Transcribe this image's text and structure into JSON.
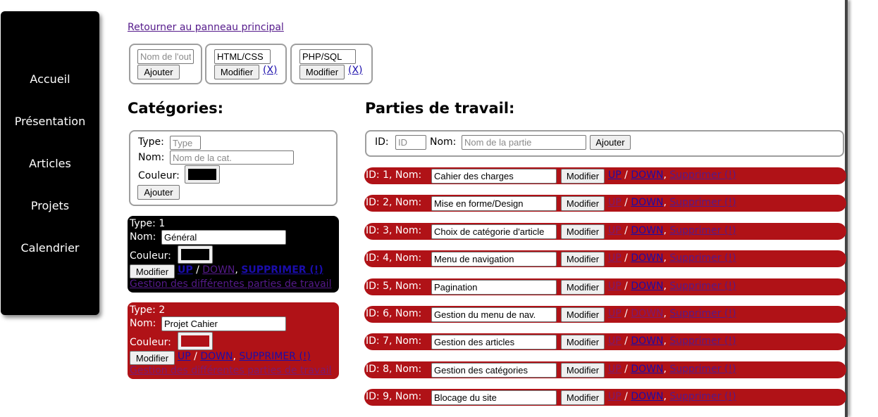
{
  "sidebar": {
    "items": [
      {
        "label": "Accueil"
      },
      {
        "label": "Présentation"
      },
      {
        "label": "Articles"
      },
      {
        "label": "Projets"
      },
      {
        "label": "Calendrier"
      }
    ]
  },
  "back_link": "Retourner au panneau principal",
  "tools": {
    "new": {
      "placeholder": "Nom de l'outil",
      "add_label": "Ajouter"
    },
    "items": [
      {
        "value": "HTML/CSS",
        "modify_label": "Modifier",
        "delete_label": "(X)"
      },
      {
        "value": "PHP/SQL",
        "modify_label": "Modifier",
        "delete_label": "(X)"
      }
    ]
  },
  "categories": {
    "title": "Catégories:",
    "form": {
      "type_label": "Type:",
      "type_placeholder": "Type",
      "name_label": "Nom:",
      "name_placeholder": "Nom de la cat.",
      "color_label": "Couleur:",
      "color_value": "#000000",
      "add_label": "Ajouter"
    },
    "items": [
      {
        "type_text": "Type: 1",
        "name_label": "Nom:",
        "name_value": "Général",
        "color_label": "Couleur:",
        "color": "#000000",
        "bg": "#000000",
        "modify_label": "Modifier",
        "up_label": "UP",
        "slash": "/",
        "down_label": "DOWN",
        "comma": ",",
        "delete_label": "SUPPRIMER (!)",
        "manage_label": "Gestion des différentes parties de travail"
      },
      {
        "type_text": "Type: 2",
        "name_label": "Nom:",
        "name_value": "Projet Cahier",
        "color_label": "Couleur:",
        "color": "#b01217",
        "bg": "#b01217",
        "modify_label": "Modifier",
        "up_label": "UP",
        "slash": "/",
        "down_label": "DOWN",
        "comma": ",",
        "delete_label": "SUPPRIMER (!)",
        "manage_label": "Gestion des différentes parties de travail"
      }
    ]
  },
  "parts": {
    "title": "Parties de travail:",
    "form": {
      "id_label": "ID:",
      "id_placeholder": "ID",
      "name_label": "Nom:",
      "name_placeholder": "Nom de la partie",
      "add_label": "Ajouter"
    },
    "row_color": "#b01217",
    "modify_label": "Modifier",
    "up_label": "UP",
    "slash": "/",
    "down_label": "DOWN",
    "comma": ",",
    "delete_label": "Supprimer (!)",
    "rows": [
      {
        "label": "ID: 1, Nom:",
        "value": "Cahier des charges"
      },
      {
        "label": "ID: 2, Nom:",
        "value": "Mise en forme/Design"
      },
      {
        "label": "ID: 3, Nom:",
        "value": "Choix de catégorie d'article"
      },
      {
        "label": "ID: 4, Nom:",
        "value": "Menu de navigation"
      },
      {
        "label": "ID: 5, Nom:",
        "value": "Pagination"
      },
      {
        "label": "ID: 6, Nom:",
        "value": "Gestion du menu de nav."
      },
      {
        "label": "ID: 7, Nom:",
        "value": "Gestion des articles"
      },
      {
        "label": "ID: 8, Nom:",
        "value": "Gestion des catégories"
      },
      {
        "label": "ID: 9, Nom:",
        "value": "Blocage du site"
      }
    ]
  }
}
